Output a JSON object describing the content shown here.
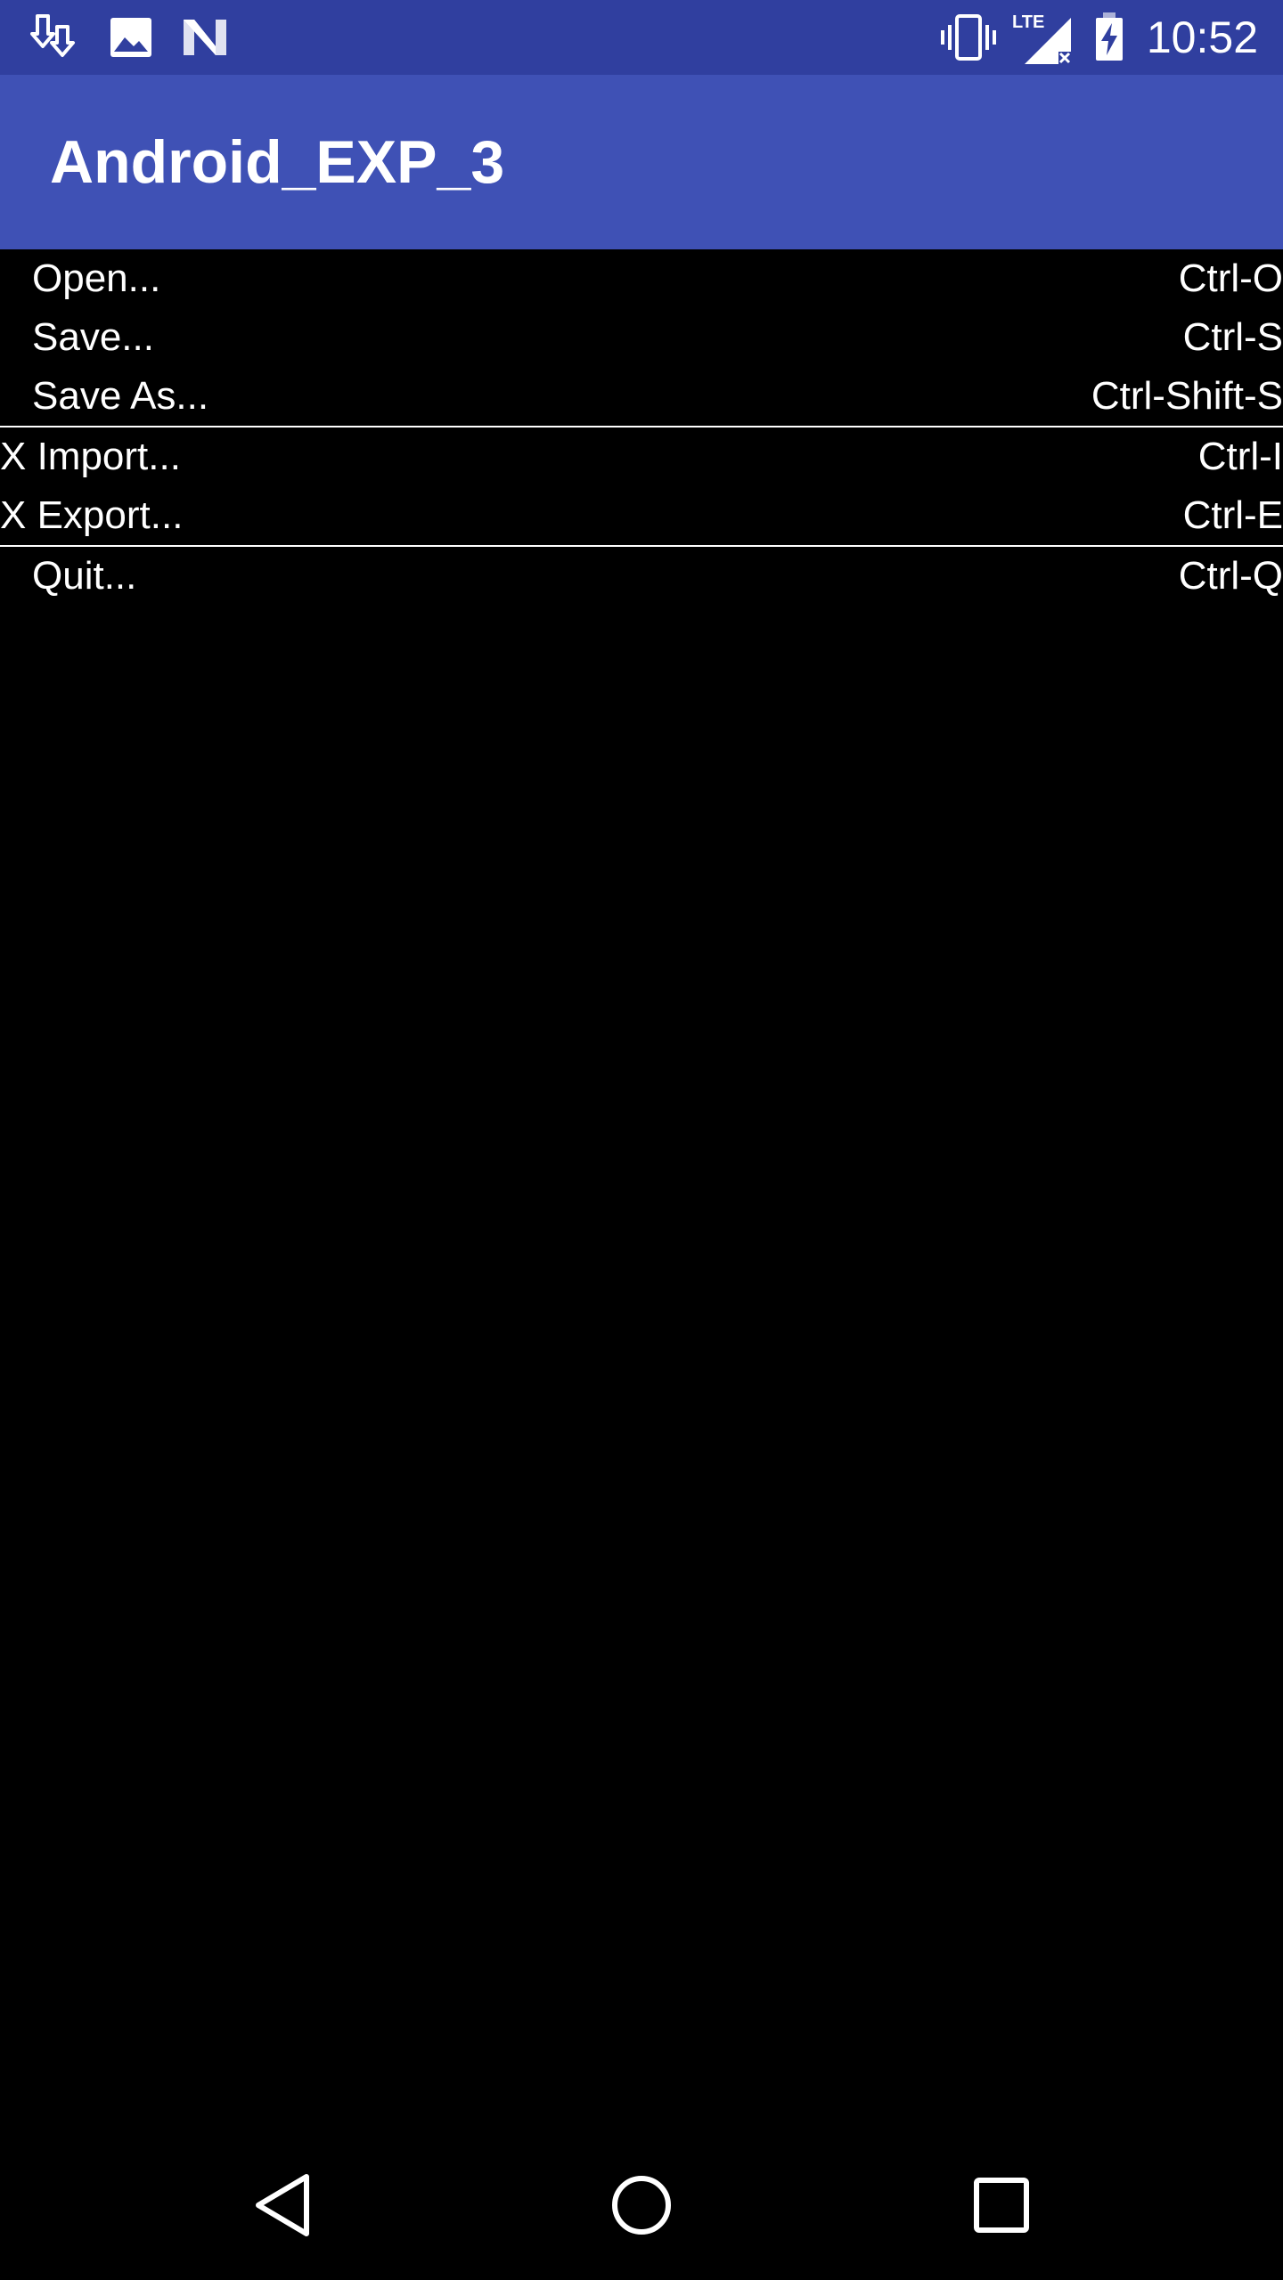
{
  "status_bar": {
    "time": "10:52",
    "left_icons": [
      "download-icon",
      "image-icon",
      "n-logo-icon"
    ],
    "right_icons": [
      "vibrate-icon",
      "lte-no-signal-icon",
      "battery-charging-icon"
    ],
    "network_label": "LTE",
    "bg_color": "#303f9f"
  },
  "app_bar": {
    "title": "Android_EXP_3",
    "bg_color": "#3f51b5"
  },
  "menu": {
    "groups": [
      [
        {
          "label": "Open...",
          "shortcut": "Ctrl-O"
        },
        {
          "label": "Save...",
          "shortcut": "Ctrl-S"
        },
        {
          "label": "Save As...",
          "shortcut": "Ctrl-Shift-S"
        }
      ],
      [
        {
          "label": "X Import...",
          "shortcut": "Ctrl-I"
        },
        {
          "label": "X Export...",
          "shortcut": "Ctrl-E"
        }
      ],
      [
        {
          "label": "Quit...",
          "shortcut": "Ctrl-Q"
        }
      ]
    ]
  },
  "nav_bar": {
    "buttons": [
      "back-icon",
      "home-icon",
      "recents-icon"
    ]
  }
}
